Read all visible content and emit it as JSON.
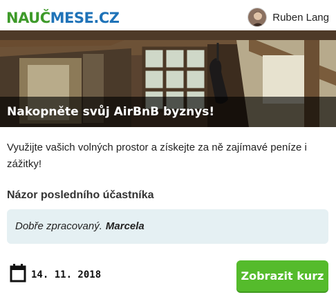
{
  "header": {
    "logo_part1": "NAUČ",
    "logo_part2": "MESE.CZ",
    "user_name": "Ruben Lang"
  },
  "course": {
    "title": "Nakopněte svůj AirBnB byznys!",
    "description": "Využijte vašich volných prostor a získejte za ně zajímavé peníze i zážitky!",
    "review_label": "Názor posledního účastníka",
    "review_text": "Dobře zpracovaný.",
    "review_author": "Marcela",
    "date": "14. 11. 2018",
    "cta_label": "Zobrazit kurz"
  },
  "colors": {
    "logo_green": "#3e9a2a",
    "logo_blue": "#1f73b8",
    "cta_green": "#55bb2c",
    "review_bg": "#e5f0f3"
  },
  "icons": [
    "calendar-icon",
    "avatar"
  ]
}
